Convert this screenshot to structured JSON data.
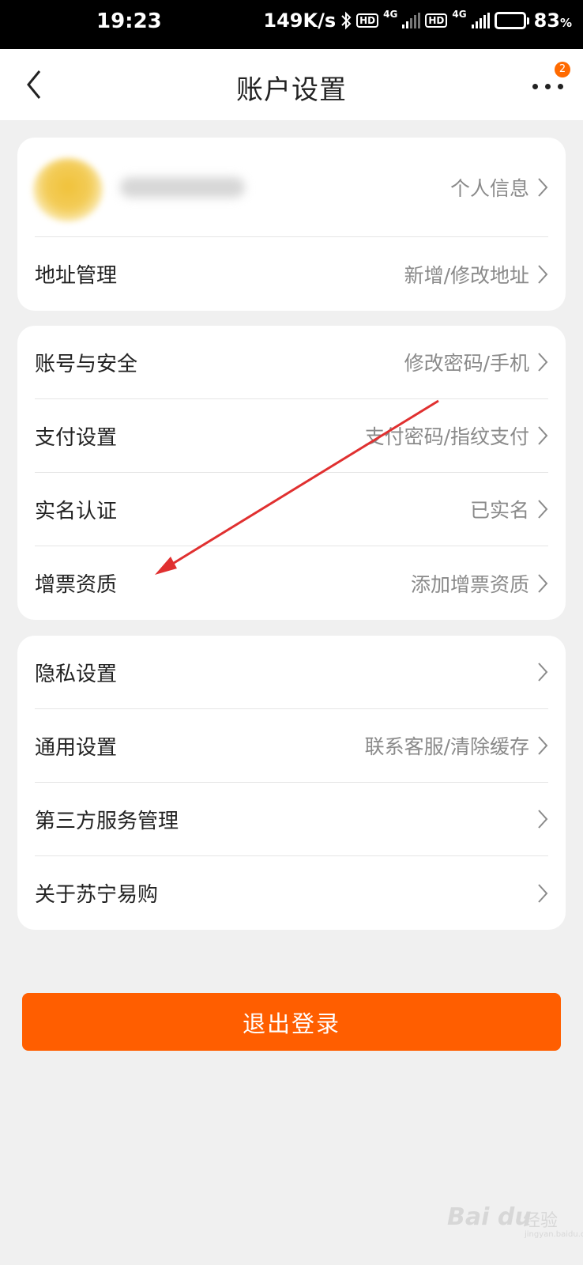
{
  "status_bar": {
    "time": "19:23",
    "net_speed": "149K/s",
    "hd1": "HD",
    "net1": "4G",
    "hd2": "HD",
    "net2": "4G",
    "battery_percent": "83",
    "battery_unit": "%",
    "battery_level": 0.83
  },
  "header": {
    "title": "账户设置",
    "more_badge": "2"
  },
  "profile": {
    "link_label": "个人信息"
  },
  "group1": [
    {
      "label": "地址管理",
      "value": "新增/修改地址"
    }
  ],
  "group2": [
    {
      "label": "账号与安全",
      "value": "修改密码/手机"
    },
    {
      "label": "支付设置",
      "value": "支付密码/指纹支付"
    },
    {
      "label": "实名认证",
      "value": "已实名"
    },
    {
      "label": "增票资质",
      "value": "添加增票资质"
    }
  ],
  "group3": [
    {
      "label": "隐私设置",
      "value": ""
    },
    {
      "label": "通用设置",
      "value": "联系客服/清除缓存"
    },
    {
      "label": "第三方服务管理",
      "value": ""
    },
    {
      "label": "关于苏宁易购",
      "value": ""
    }
  ],
  "logout_label": "退出登录",
  "watermark": {
    "logo": "Bai du",
    "text": "经验",
    "sub": "jingyan.baidu.com"
  },
  "colors": {
    "accent": "#ff5e00",
    "badge": "#ff6a00",
    "annotation_arrow": "#e03030"
  }
}
